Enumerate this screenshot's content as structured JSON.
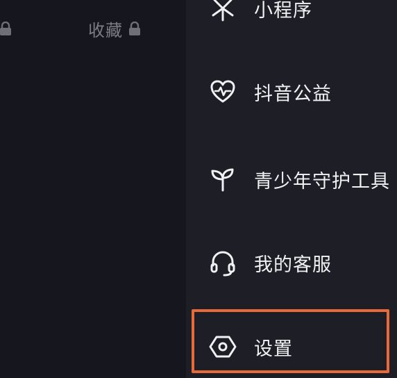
{
  "profile_tabs": {
    "favorites_label": "收藏"
  },
  "menu": {
    "items": [
      {
        "label": "小程序",
        "icon": "mini-program-icon"
      },
      {
        "label": "抖音公益",
        "icon": "charity-heart-icon"
      },
      {
        "label": "青少年守护工具",
        "icon": "sprout-icon"
      },
      {
        "label": "我的客服",
        "icon": "headset-icon"
      },
      {
        "label": "设置",
        "icon": "settings-hexagon-icon"
      }
    ]
  },
  "highlight": {
    "target": "设置",
    "color": "#e86a3a"
  },
  "colors": {
    "background": "#15161c",
    "drawer_background": "#1d1e26",
    "text_primary": "#f1f1f3",
    "text_muted": "#7c7d84"
  }
}
